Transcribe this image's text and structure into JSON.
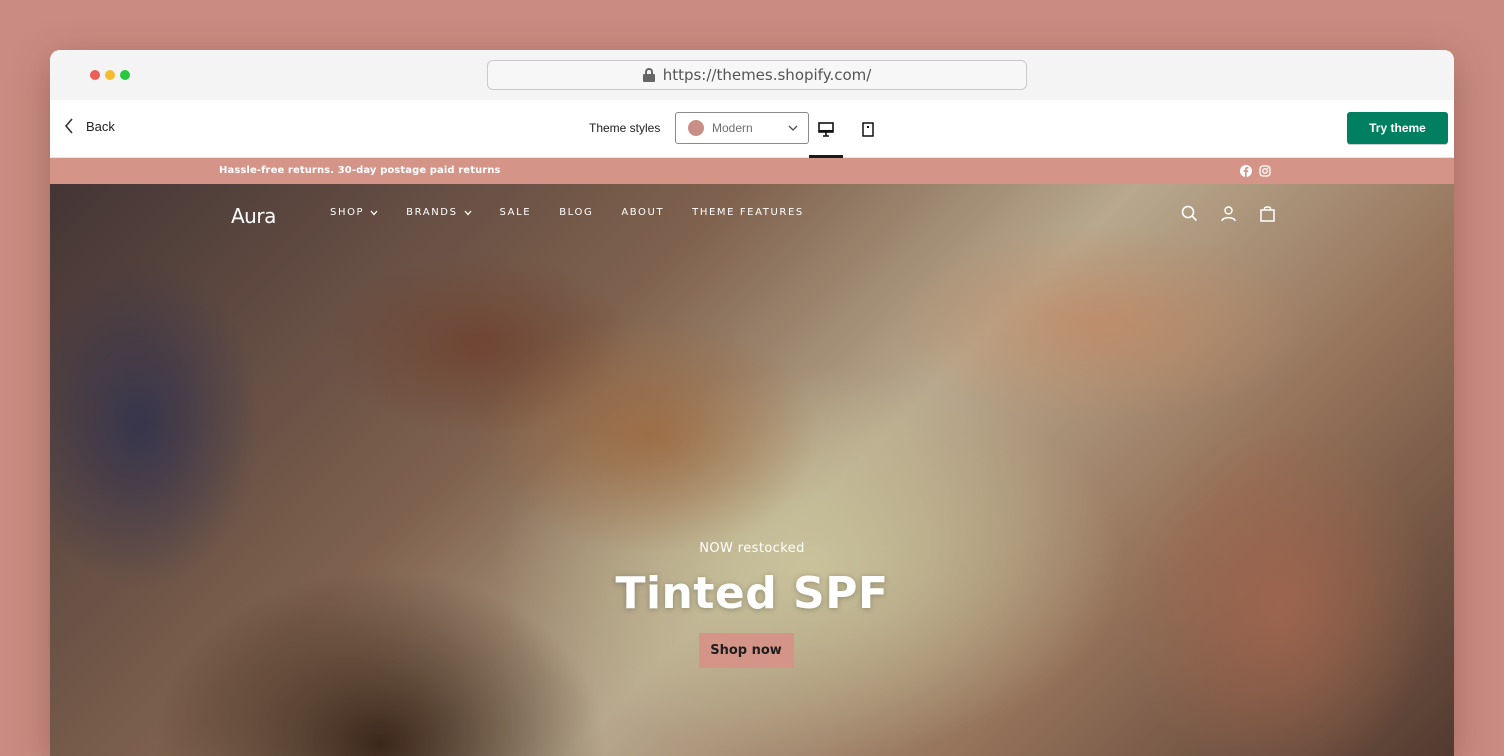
{
  "browser": {
    "url": "https://themes.shopify.com/",
    "traffic_lights": [
      "#ec5f57",
      "#f4bd2f",
      "#2ac840"
    ]
  },
  "toolbar": {
    "back_label": "Back",
    "theme_styles_label": "Theme styles",
    "style_selected": "Modern",
    "style_swatch_color": "#c98f86",
    "active_device": "desktop",
    "try_theme_label": "Try theme",
    "try_theme_color": "#008060"
  },
  "store": {
    "announcement": "Hassle-free returns. 30-day postage paid returns",
    "accent_color": "#d49488",
    "logo": "Aura",
    "nav": [
      {
        "label": "SHOP",
        "dropdown": true
      },
      {
        "label": "BRANDS",
        "dropdown": true
      },
      {
        "label": "SALE",
        "dropdown": false
      },
      {
        "label": "BLOG",
        "dropdown": false
      },
      {
        "label": "ABOUT",
        "dropdown": false
      },
      {
        "label": "THEME FEATURES",
        "dropdown": false
      }
    ],
    "header_icons": [
      "search-icon",
      "account-icon",
      "cart-icon"
    ],
    "social_icons": [
      "facebook-icon",
      "instagram-icon"
    ]
  },
  "hero": {
    "eyebrow": "NOW restocked",
    "title": "Tinted SPF",
    "button_label": "Shop now"
  }
}
